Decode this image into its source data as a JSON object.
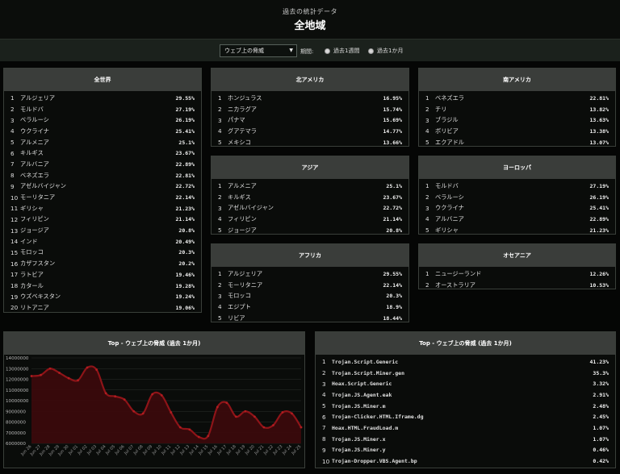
{
  "header": {
    "subtitle": "過去の統計データ",
    "title": "全地域"
  },
  "filter": {
    "select_value": "ウェブ上の脅威",
    "period_label": "期間:",
    "options": [
      {
        "label": "過去1週間",
        "checked": false
      },
      {
        "label": "過去1か月",
        "checked": true
      }
    ]
  },
  "world": {
    "title": "全世界",
    "rows": [
      {
        "rank": "1",
        "name": "アルジェリア",
        "value": "29.55%"
      },
      {
        "rank": "2",
        "name": "モルドバ",
        "value": "27.19%"
      },
      {
        "rank": "3",
        "name": "ベラルーシ",
        "value": "26.19%"
      },
      {
        "rank": "4",
        "name": "ウクライナ",
        "value": "25.41%"
      },
      {
        "rank": "5",
        "name": "アルメニア",
        "value": "25.1%"
      },
      {
        "rank": "6",
        "name": "キルギス",
        "value": "23.67%"
      },
      {
        "rank": "7",
        "name": "アルバニア",
        "value": "22.89%"
      },
      {
        "rank": "8",
        "name": "ベネズエラ",
        "value": "22.81%"
      },
      {
        "rank": "9",
        "name": "アゼルバイジャン",
        "value": "22.72%"
      },
      {
        "rank": "10",
        "name": "モーリタニア",
        "value": "22.14%"
      },
      {
        "rank": "11",
        "name": "ギリシャ",
        "value": "21.23%"
      },
      {
        "rank": "12",
        "name": "フィリピン",
        "value": "21.14%"
      },
      {
        "rank": "13",
        "name": "ジョージア",
        "value": "20.8%"
      },
      {
        "rank": "14",
        "name": "インド",
        "value": "20.49%"
      },
      {
        "rank": "15",
        "name": "モロッコ",
        "value": "20.3%"
      },
      {
        "rank": "16",
        "name": "カザフスタン",
        "value": "20.2%"
      },
      {
        "rank": "17",
        "name": "ラトビア",
        "value": "19.46%"
      },
      {
        "rank": "18",
        "name": "カタール",
        "value": "19.28%"
      },
      {
        "rank": "19",
        "name": "ウズベキスタン",
        "value": "19.24%"
      },
      {
        "rank": "20",
        "name": "リトアニア",
        "value": "19.06%"
      }
    ]
  },
  "north_america": {
    "title": "北アメリカ",
    "rows": [
      {
        "rank": "1",
        "name": "ホンジュラス",
        "value": "16.95%"
      },
      {
        "rank": "2",
        "name": "ニカラグア",
        "value": "15.74%"
      },
      {
        "rank": "3",
        "name": "パナマ",
        "value": "15.69%"
      },
      {
        "rank": "4",
        "name": "グアテマラ",
        "value": "14.77%"
      },
      {
        "rank": "5",
        "name": "メキシコ",
        "value": "13.66%"
      }
    ]
  },
  "south_america": {
    "title": "南アメリカ",
    "rows": [
      {
        "rank": "1",
        "name": "ベネズエラ",
        "value": "22.81%"
      },
      {
        "rank": "2",
        "name": "チリ",
        "value": "13.82%"
      },
      {
        "rank": "3",
        "name": "ブラジル",
        "value": "13.63%"
      },
      {
        "rank": "4",
        "name": "ボリビア",
        "value": "13.38%"
      },
      {
        "rank": "5",
        "name": "エクアドル",
        "value": "13.07%"
      }
    ]
  },
  "asia": {
    "title": "アジア",
    "rows": [
      {
        "rank": "1",
        "name": "アルメニア",
        "value": "25.1%"
      },
      {
        "rank": "2",
        "name": "キルギス",
        "value": "23.67%"
      },
      {
        "rank": "3",
        "name": "アゼルバイジャン",
        "value": "22.72%"
      },
      {
        "rank": "4",
        "name": "フィリピン",
        "value": "21.14%"
      },
      {
        "rank": "5",
        "name": "ジョージア",
        "value": "20.8%"
      }
    ]
  },
  "europe": {
    "title": "ヨーロッパ",
    "rows": [
      {
        "rank": "1",
        "name": "モルドバ",
        "value": "27.19%"
      },
      {
        "rank": "2",
        "name": "ベラルーシ",
        "value": "26.19%"
      },
      {
        "rank": "3",
        "name": "ウクライナ",
        "value": "25.41%"
      },
      {
        "rank": "4",
        "name": "アルバニア",
        "value": "22.89%"
      },
      {
        "rank": "5",
        "name": "ギリシャ",
        "value": "21.23%"
      }
    ]
  },
  "africa": {
    "title": "アフリカ",
    "rows": [
      {
        "rank": "1",
        "name": "アルジェリア",
        "value": "29.55%"
      },
      {
        "rank": "2",
        "name": "モーリタニア",
        "value": "22.14%"
      },
      {
        "rank": "3",
        "name": "モロッコ",
        "value": "20.3%"
      },
      {
        "rank": "4",
        "name": "エジプト",
        "value": "18.9%"
      },
      {
        "rank": "5",
        "name": "リビア",
        "value": "18.44%"
      }
    ]
  },
  "oceania": {
    "title": "オセアニア",
    "rows": [
      {
        "rank": "1",
        "name": "ニュージーランド",
        "value": "12.26%"
      },
      {
        "rank": "2",
        "name": "オーストラリア",
        "value": "10.53%"
      }
    ]
  },
  "threats": {
    "title": "Top - ウェブ上の脅威 (過去 1か月)",
    "rows": [
      {
        "rank": "1",
        "name": "Trojan.Script.Generic",
        "value": "41.23%"
      },
      {
        "rank": "2",
        "name": "Trojan.Script.Miner.gen",
        "value": "35.3%"
      },
      {
        "rank": "3",
        "name": "Hoax.Script.Generic",
        "value": "3.32%"
      },
      {
        "rank": "4",
        "name": "Trojan.JS.Agent.eak",
        "value": "2.91%"
      },
      {
        "rank": "5",
        "name": "Trojan.JS.Miner.m",
        "value": "2.48%"
      },
      {
        "rank": "6",
        "name": "Trojan-Clicker.HTML.Iframe.dg",
        "value": "2.45%"
      },
      {
        "rank": "7",
        "name": "Hoax.HTML.FraudLoad.m",
        "value": "1.07%"
      },
      {
        "rank": "8",
        "name": "Trojan.JS.Miner.x",
        "value": "1.07%"
      },
      {
        "rank": "9",
        "name": "Trojan.JS.Miner.y",
        "value": "0.46%"
      },
      {
        "rank": "10",
        "name": "Trojan-Dropper.VBS.Agent.bp",
        "value": "0.42%"
      }
    ]
  },
  "chart_data": {
    "type": "area",
    "title": "Top - ウェブ上の脅威 (過去 1か月)",
    "ylim": [
      6000000,
      14000000
    ],
    "yticks": [
      "14000000",
      "13000000",
      "12000000",
      "11000000",
      "10000000",
      "9000000",
      "8000000",
      "7000000",
      "6000000"
    ],
    "x": [
      "Jun 26",
      "Jun 27",
      "Jun 28",
      "Jun 29",
      "Jun 30",
      "Jul 01",
      "Jul 02",
      "Jul 03",
      "Jul 04",
      "Jul 05",
      "Jul 06",
      "Jul 07",
      "Jul 08",
      "Jul 09",
      "Jul 10",
      "Jul 11",
      "Jul 12",
      "Jul 13",
      "Jul 14",
      "Jul 15",
      "Jul 16",
      "Jul 17",
      "Jul 18",
      "Jul 19",
      "Jul 20",
      "Jul 21",
      "Jul 22",
      "Jul 23",
      "Jul 24",
      "Jul 25"
    ],
    "values": [
      12300000,
      12400000,
      13000000,
      12600000,
      12100000,
      11900000,
      13100000,
      12900000,
      10700000,
      10400000,
      10100000,
      9000000,
      8800000,
      10600000,
      10500000,
      8900000,
      7500000,
      7300000,
      6600000,
      6700000,
      9400000,
      9800000,
      8500000,
      9000000,
      8500000,
      7500000,
      7700000,
      8900000,
      8800000,
      7500000
    ],
    "color": "#8e1418",
    "grid": true
  }
}
